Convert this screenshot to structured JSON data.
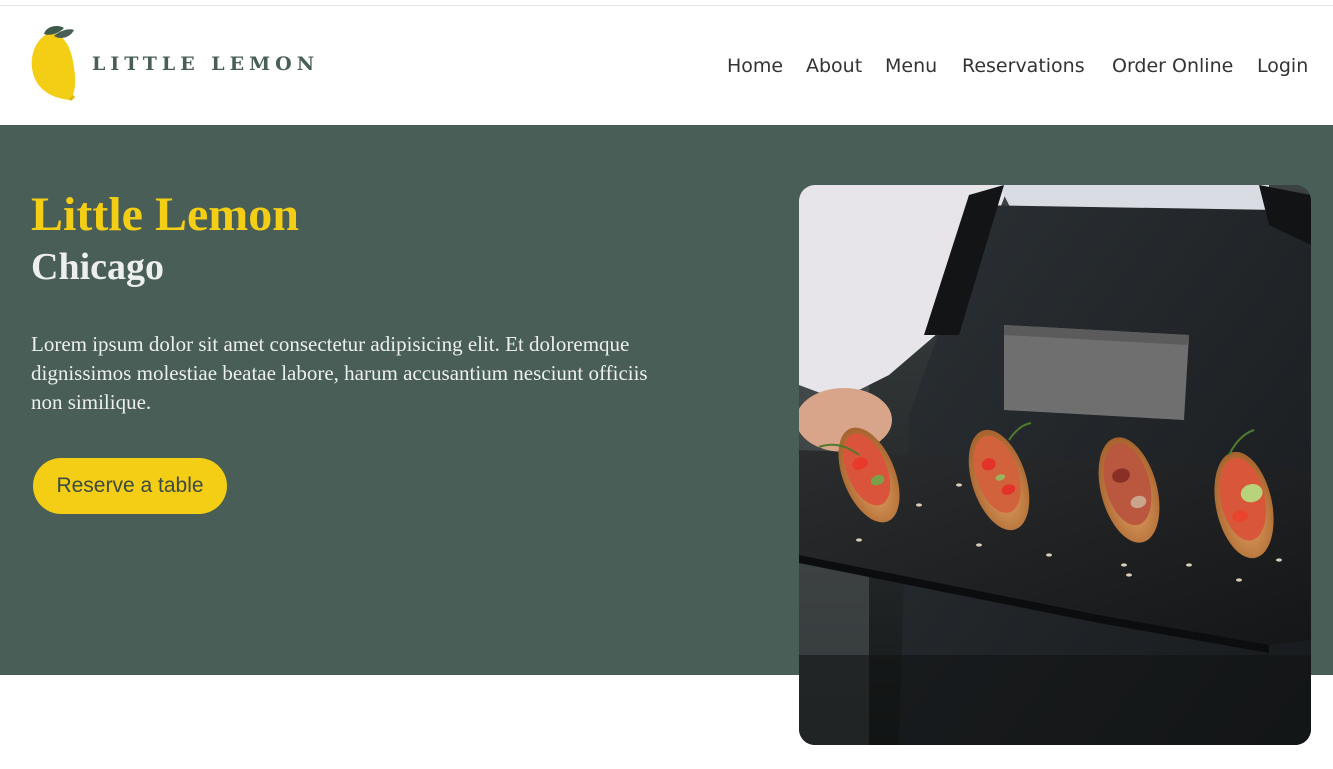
{
  "header": {
    "logo_text": "LITTLE LEMON",
    "logo_icon": "lemon-icon",
    "nav": [
      "Home",
      "About",
      "Menu",
      "Reservations",
      "Order Online",
      "Login"
    ]
  },
  "hero": {
    "title": "Little Lemon",
    "subtitle": "Chicago",
    "description": "Lorem ipsum dolor sit amet consectetur adipisicing elit. Et doloremque dignissimos molestiae beatae labore, harum accusantium nesciunt officiis non similique.",
    "cta_label": "Reserve a table",
    "image": "server holding a slate tray of bruschetta"
  },
  "colors": {
    "brand_green": "#495e57",
    "brand_yellow": "#f4ce14",
    "text_light": "#edefee"
  }
}
